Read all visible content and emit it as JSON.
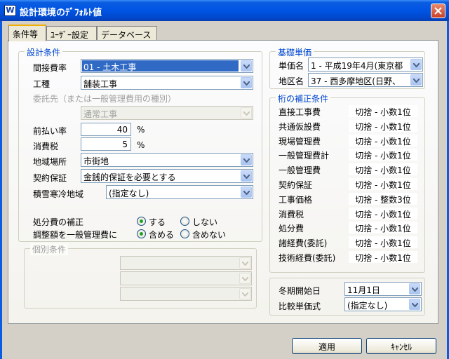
{
  "window": {
    "icon_label": "W",
    "title": "設計環境のﾃﾞﾌｫﾙﾄ値"
  },
  "tabs": [
    {
      "label": "条件等"
    },
    {
      "label": "ﾕｰｻﾞｰ設定"
    },
    {
      "label": "データベース"
    }
  ],
  "design": {
    "legend": "設計条件",
    "indirect_rate": {
      "label": "間接費率",
      "value": "01 - 土木工事"
    },
    "work_type": {
      "label": "工種",
      "value": "舗装工事"
    },
    "consignment": {
      "label": "委託先（または一般管理費用の種別）",
      "value": "通常工事"
    },
    "advance_rate": {
      "label": "前払い率",
      "value": "40",
      "unit": "%"
    },
    "consumption_tax": {
      "label": "消費税",
      "value": "5",
      "unit": "%"
    },
    "region": {
      "label": "地域場所",
      "value": "市街地"
    },
    "guarantee": {
      "label": "契約保証",
      "value": "金銭的保証を必要とする"
    },
    "snow_cold": {
      "label": "積雪寒冷地域",
      "value": "(指定なし)"
    },
    "disposal": {
      "label": "処分費の補正",
      "opt_yes": "する",
      "opt_no": "しない",
      "selected": "yes"
    },
    "adjustment": {
      "label": "調整額を一般管理費に",
      "opt_yes": "含める",
      "opt_no": "含めない",
      "selected": "yes"
    }
  },
  "individual": {
    "legend": "個別条件"
  },
  "base_price": {
    "legend": "基礎単価",
    "unit_price": {
      "label": "単価名",
      "value": "1 - 平成19年4月(東京都"
    },
    "district": {
      "label": "地区名",
      "value": "37 - 西多摩地区(日野、"
    }
  },
  "rounding": {
    "legend": "桁の補正条件",
    "rows": [
      {
        "label": "直接工事費",
        "value": "切捨 - 小数1位"
      },
      {
        "label": "共通仮設費",
        "value": "切捨 - 小数1位"
      },
      {
        "label": "現場管理費",
        "value": "切捨 - 小数1位"
      },
      {
        "label": "一般管理費計",
        "value": "切捨 - 小数1位"
      },
      {
        "label": "一般管理費",
        "value": "切捨 - 小数1位"
      },
      {
        "label": "契約保証",
        "value": "切捨 - 小数1位"
      },
      {
        "label": "工事価格",
        "value": "切捨 - 整数3位"
      },
      {
        "label": "消費税",
        "value": "切捨 - 小数1位"
      },
      {
        "label": "処分費",
        "value": "切捨 - 小数1位"
      },
      {
        "label": "諸経費(委託)",
        "value": "切捨 - 小数1位"
      },
      {
        "label": "技術経費(委託)",
        "value": "切捨 - 小数1位"
      }
    ]
  },
  "winter": {
    "start": {
      "label": "冬期開始日",
      "value": "11月1日"
    },
    "compare": {
      "label": "比較単価式",
      "value": "(指定なし)"
    }
  },
  "buttons": {
    "apply": "適用",
    "cancel": "ｷｬﾝｾﾙ"
  },
  "colors": {
    "titlebar": "#0054e3",
    "legend": "#0046d5",
    "selection": "#316ac5",
    "radio_dot": "#21a121"
  }
}
